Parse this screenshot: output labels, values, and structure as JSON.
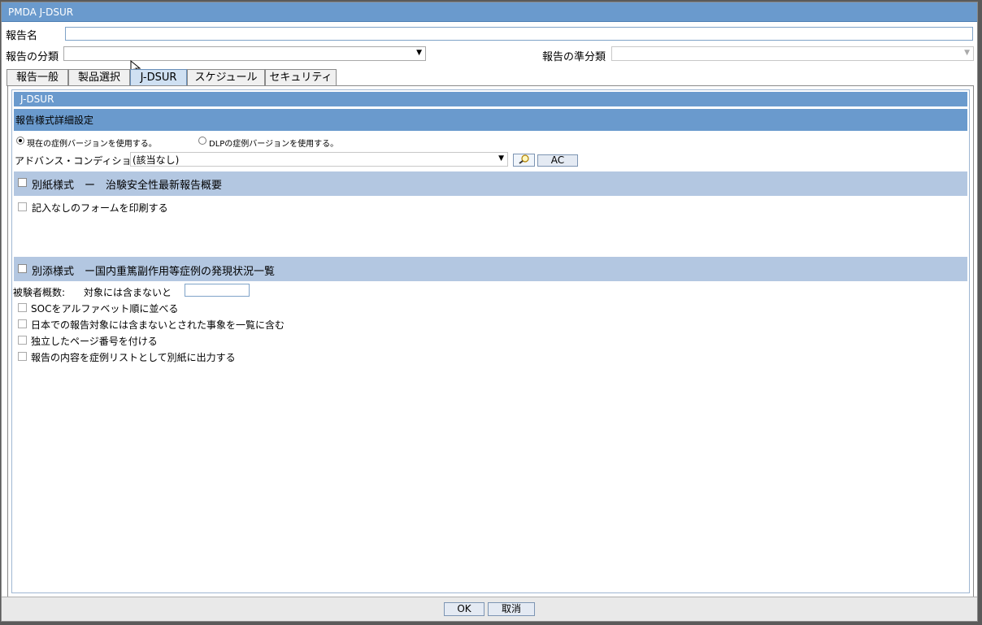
{
  "window": {
    "title": "PMDA J-DSUR"
  },
  "header": {
    "report_name_label": "報告名",
    "report_name_value": "",
    "report_category_label": "報告の分類",
    "report_category_value": "",
    "report_sub_category_label": "報告の準分類",
    "report_sub_category_value": ""
  },
  "tabs": [
    {
      "label": "報告一般"
    },
    {
      "label": "製品選択"
    },
    {
      "label": "J-DSUR",
      "active": true
    },
    {
      "label": "スケジュール"
    },
    {
      "label": "セキュリティ"
    }
  ],
  "panel": {
    "section_title": "J-DSUR",
    "subsection_title": "報告様式詳細設定",
    "radio_current": "現在の症例バージョンを使用する。",
    "radio_dlp": "DLPの症例バージョンを使用する。",
    "advanced_condition_label": "アドバンス・コンディション",
    "advanced_condition_value": "(該当なし)",
    "ac_button": "AC",
    "appendix1_title": "別紙様式　ー　治験安全性最新報告概要",
    "print_blank_form": "記入なしのフォームを印刷する",
    "appendix2_title": "別添様式　ー国内重篤副作用等症例の発現状況一覧",
    "subjects_label": "被験者概数:",
    "subjects_note": "対象には含まないと",
    "subjects_value": "",
    "options": [
      "SOCをアルファベット順に並べる",
      "日本での報告対象には含まないとされた事象を一覧に含む",
      "独立したページ番号を付ける",
      "報告の内容を症例リストとして別紙に出力する"
    ]
  },
  "footer": {
    "ok_label": "OK",
    "cancel_label": "取消"
  },
  "icons": {
    "search": "search-icon",
    "dropdown": "chevron-down-icon"
  },
  "colors": {
    "title_bar": "#6a9acd",
    "section_light": "#b3c7e1"
  }
}
